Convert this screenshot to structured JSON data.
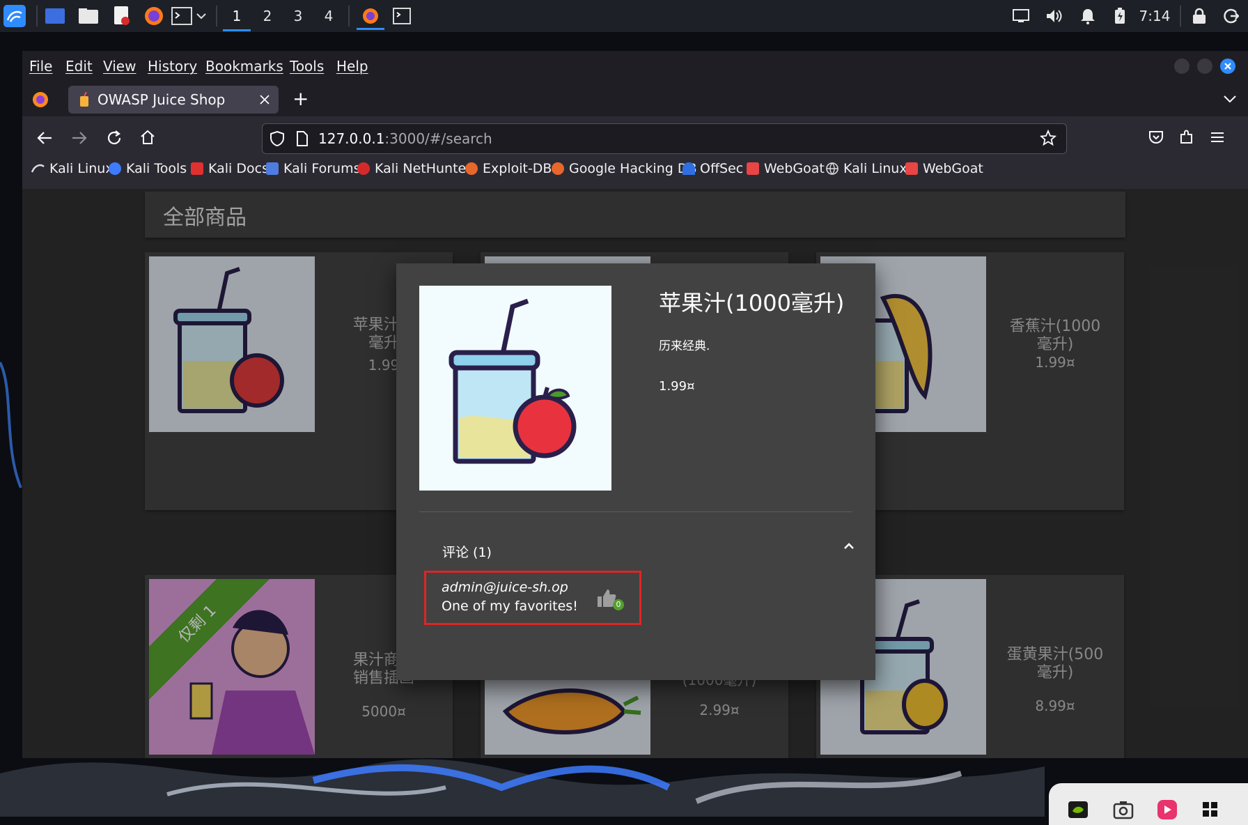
{
  "taskbar": {
    "workspaces": [
      "1",
      "2",
      "3",
      "4"
    ],
    "active_workspace": "1",
    "clock": "7:14"
  },
  "browser": {
    "menu": [
      "File",
      "Edit",
      "View",
      "History",
      "Bookmarks",
      "Tools",
      "Help"
    ],
    "tab_title": "OWASP Juice Shop",
    "new_tab": "+",
    "url_host": "127.0.0.1",
    "url_rest": ":3000/#/search",
    "bookmarks": [
      "Kali Linux",
      "Kali Tools",
      "Kali Docs",
      "Kali Forums",
      "Kali NetHunter",
      "Exploit-DB",
      "Google Hacking DB",
      "OffSec",
      "WebGoat",
      "Kali Linux",
      "WebGoat"
    ]
  },
  "page": {
    "heading": "全部商品",
    "products": [
      {
        "name": "苹果汁(1\n毫升",
        "price": "1.99"
      },
      {
        "name": "香蕉汁(1000\n毫升)",
        "price": "1.99¤"
      },
      {
        "name": "果汁商店\n销售插画",
        "price": "5000¤",
        "ribbon": "仅剩 1"
      },
      {
        "name": "(1000毫升)",
        "price": "2.99¤"
      },
      {
        "name": "蛋黄果汁(500\n毫升)",
        "price": "8.99¤"
      }
    ]
  },
  "dialog": {
    "name": "苹果汁(1000毫升)",
    "description": "历来经典.",
    "price": "1.99¤",
    "reviews_header": "评论 (1)",
    "review": {
      "author": "admin@juice-sh.op",
      "text": "One of my favorites!",
      "likes": "0"
    }
  },
  "colors": {
    "accent_blue": "#2f8cff",
    "highlight_red": "#e02424",
    "ribbon_green": "#55a02e"
  }
}
